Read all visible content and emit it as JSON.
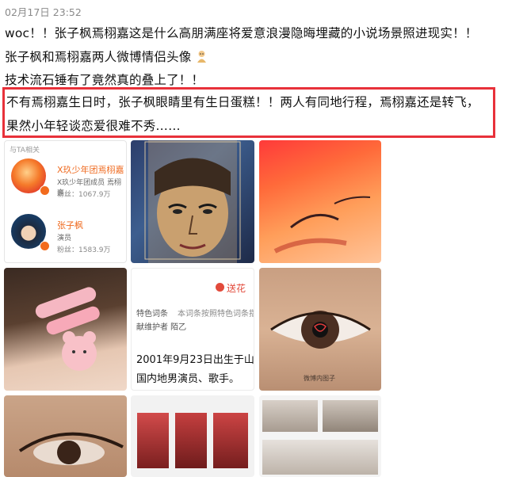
{
  "post": {
    "timestamp": "02月17日 23:52",
    "lines": [
      "woc！！张子枫焉栩嘉这是什么高朋满座将爱意浪漫隐晦埋藏的小说场景照进现实！！",
      "张子枫和焉栩嘉两人微博情侣头像",
      "技术流石锤有了竟然真的叠上了！！",
      "不有焉栩嘉生日时，张子枫眼睛里有生日蛋糕！！两人有同地行程，焉栩嘉还是转飞，",
      "果然小年轻谈恋爱很难不秀……"
    ]
  },
  "related_card": {
    "title": "与TA相关",
    "users": [
      {
        "name": "X玖少年团焉栩嘉",
        "desc": "X玖少年团成员 焉栩嘉",
        "fans_label": "粉丝：",
        "fans": "1067.9万"
      },
      {
        "name": "张子枫",
        "desc": "演员",
        "fans_label": "粉丝：",
        "fans": "1583.9万"
      }
    ]
  },
  "baike": {
    "brand": "送花",
    "header_left": "特色词条",
    "header_desc": "本词条按照特色词条指南",
    "maintainer": "献维护者 陌乙",
    "bio_line1": "2001年9月23日出生于山",
    "bio_line2": "国内地男演员、歌手。"
  },
  "eye_caption": "微博内图子",
  "colors": {
    "highlight": "#e8313a",
    "accent_orange": "#f26b1d"
  }
}
